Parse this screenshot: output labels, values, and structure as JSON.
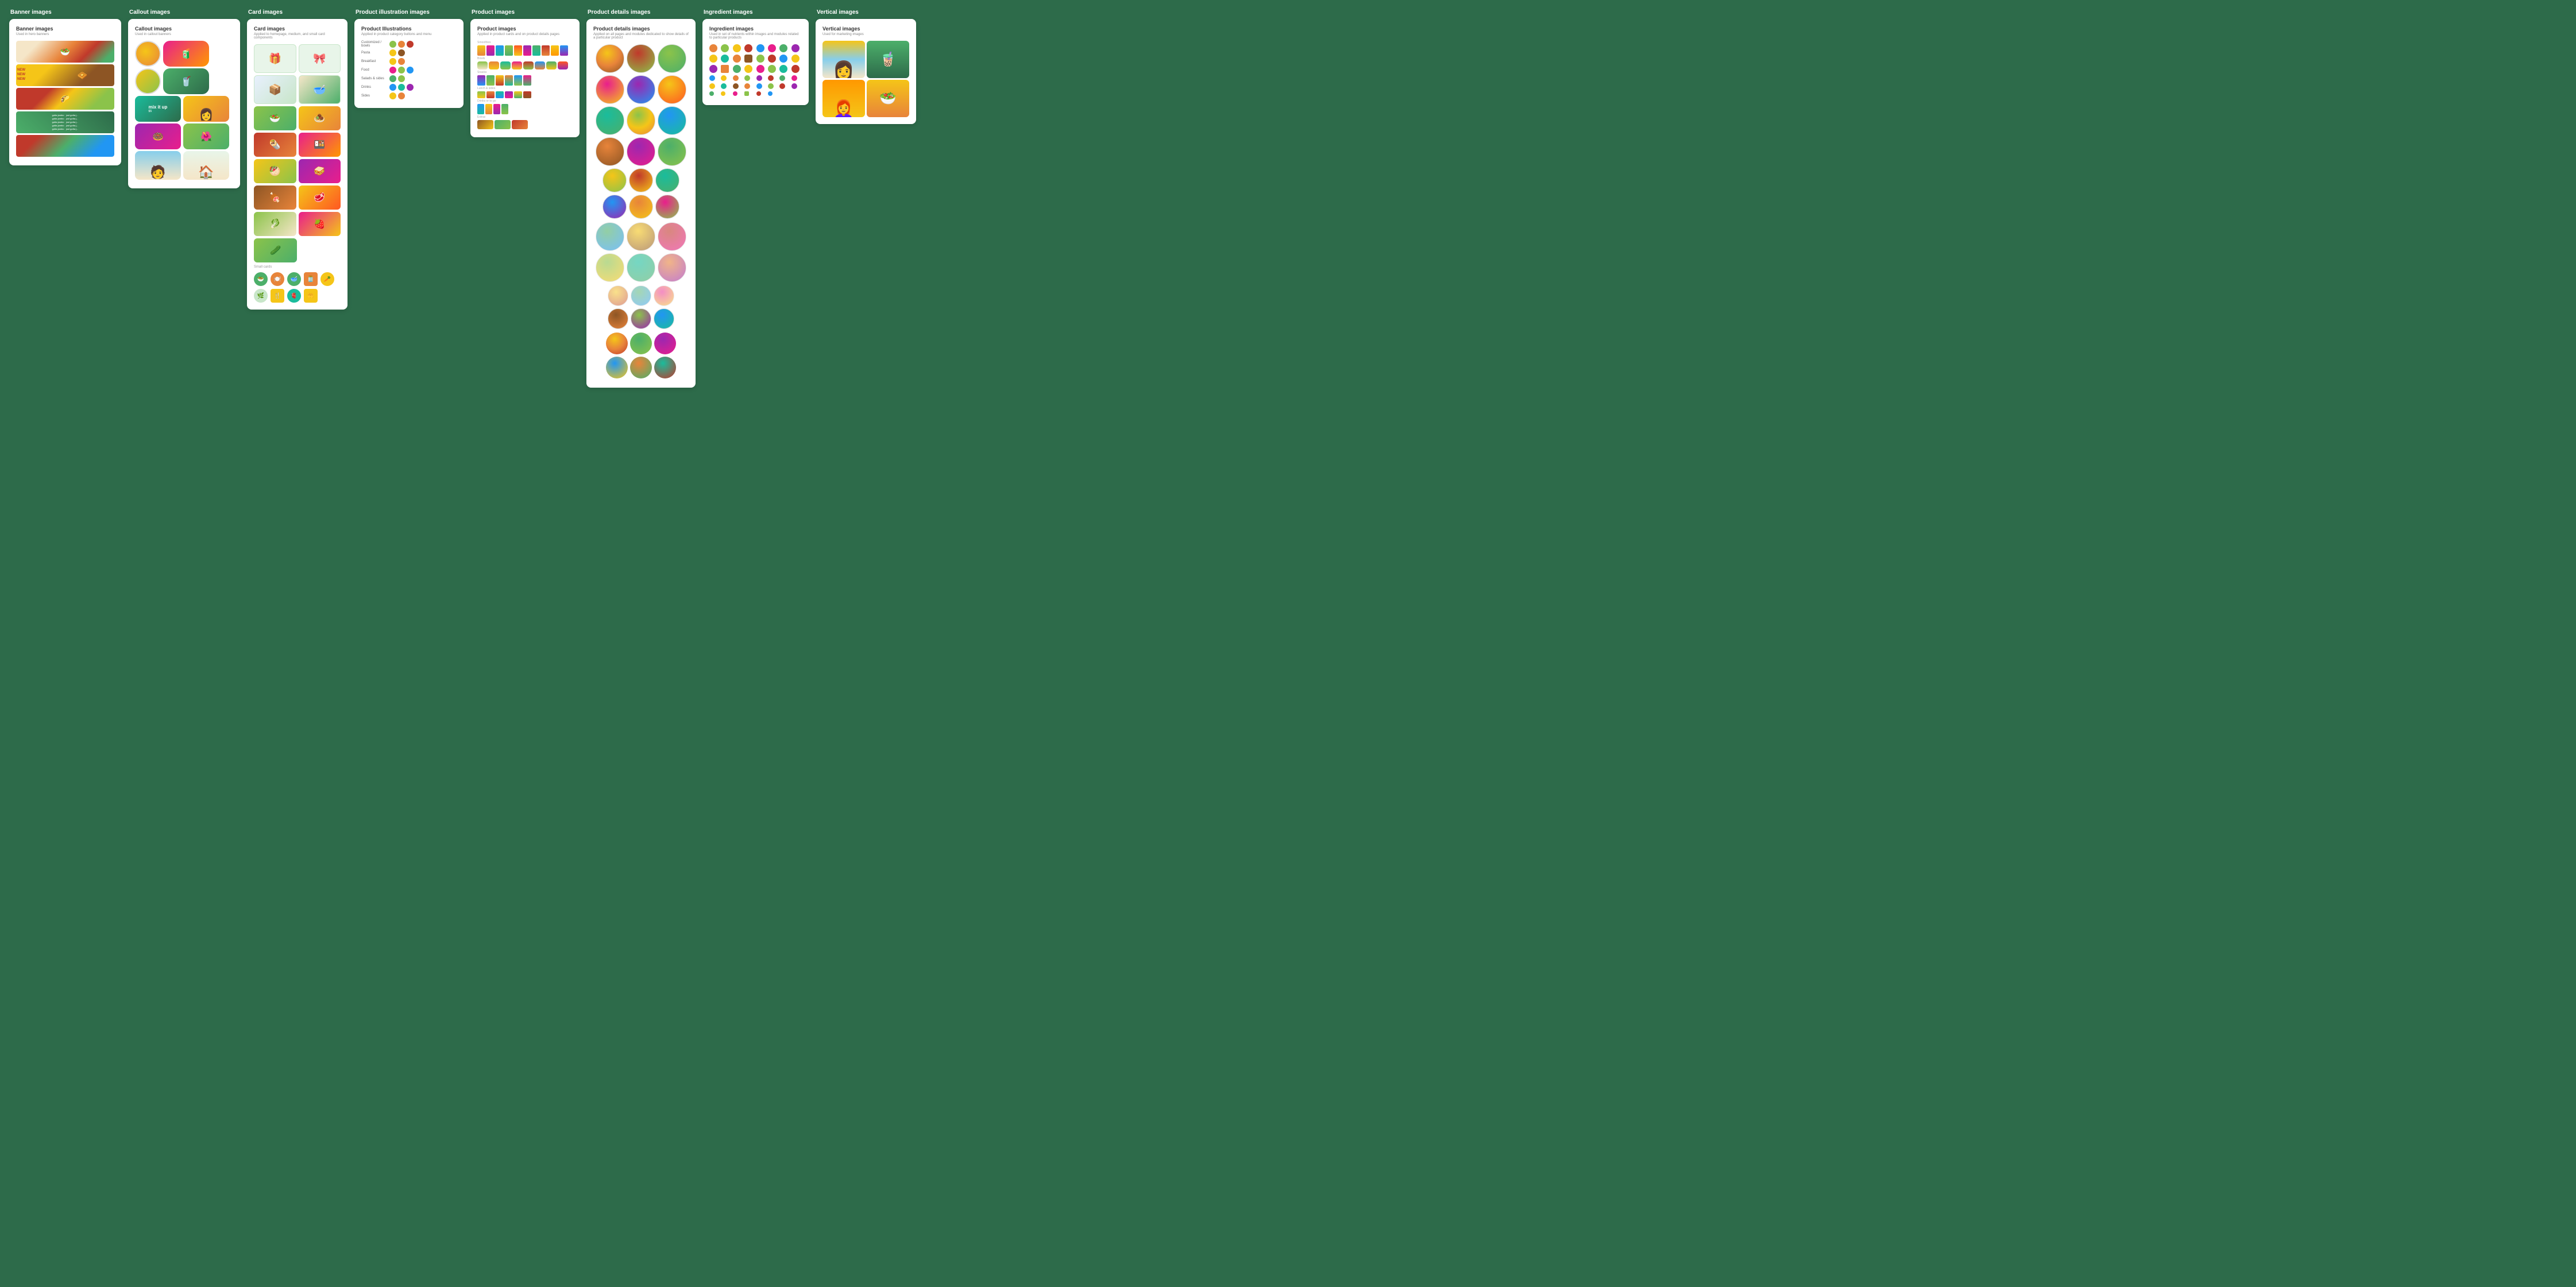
{
  "columns": [
    {
      "id": "banner",
      "header": "Banner images",
      "card": {
        "title": "Banner images",
        "subtitle": "Used in hero banners"
      }
    },
    {
      "id": "callout",
      "header": "Callout images",
      "card": {
        "title": "Callout images",
        "subtitle": "Used in callout banners"
      }
    },
    {
      "id": "card",
      "header": "Card images",
      "card": {
        "title": "Card images",
        "subtitle": "Applied to homepage, medium, and small card components"
      }
    },
    {
      "id": "product-illus",
      "header": "Product illustration images",
      "card": {
        "title": "Product Illustrations",
        "subtitle": "Applied in product category buttons and menu"
      }
    },
    {
      "id": "product",
      "header": "Product images",
      "card": {
        "title": "Product images",
        "subtitle": "Applied in product cards and on product details pages"
      }
    },
    {
      "id": "details",
      "header": "Product details images",
      "card": {
        "title": "Product details images",
        "subtitle": "Applied on all pages and modules dedicated to show details of a particular product"
      }
    },
    {
      "id": "ingredient",
      "header": "Ingredient images",
      "card": {
        "title": "Ingredient images",
        "subtitle": "Used in set of nutrients within images and modules related to particular products"
      }
    },
    {
      "id": "vertical",
      "header": "Vertical images",
      "card": {
        "title": "Vertical images",
        "subtitle": "Used for marketing images"
      }
    }
  ],
  "labels": {
    "small_cards": "Small cards",
    "medium_cards": "Medium cards",
    "large_cards": "Large cards",
    "new": "NEW",
    "gotta_jambo": "gotta jambo",
    "just_gotta_jambo": "just gotta jambo",
    "mix_it_up": "mix it up"
  }
}
